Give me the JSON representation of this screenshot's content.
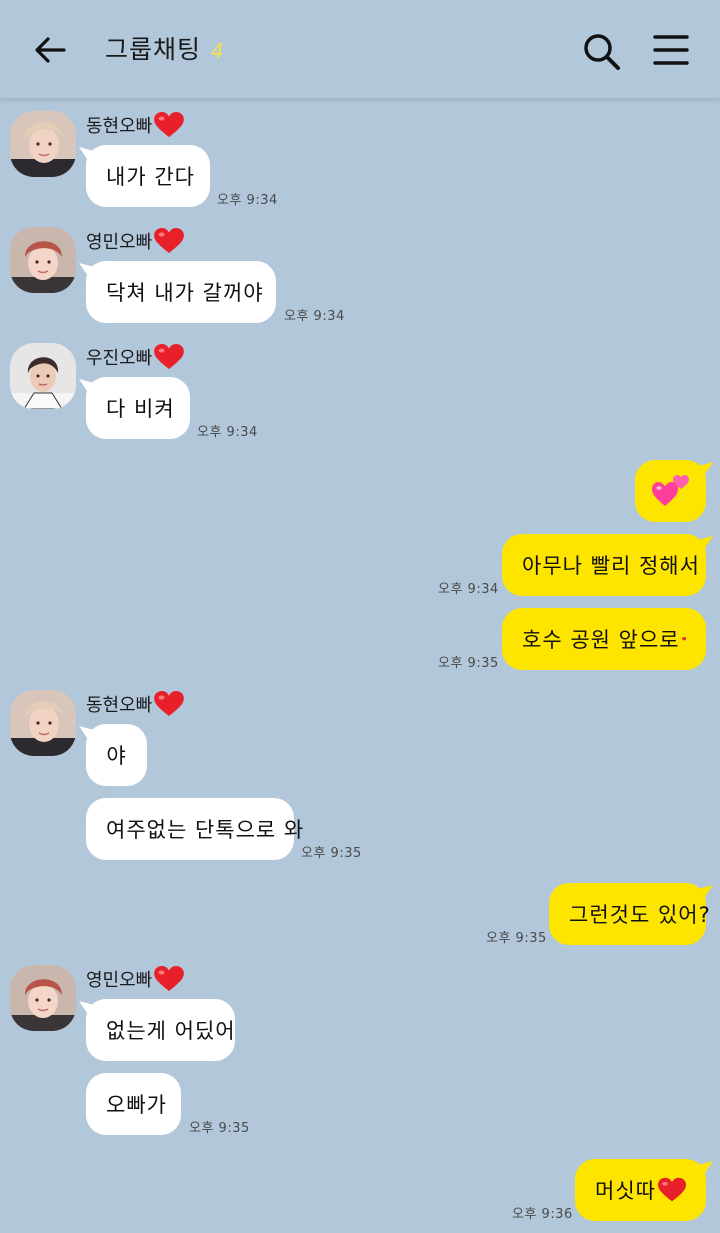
{
  "header": {
    "title": "그룹채팅",
    "member_count": "4",
    "back_icon": "back-arrow-icon",
    "search_icon": "search-icon",
    "menu_icon": "hamburger-menu-icon"
  },
  "messages": [
    {
      "sender": "동현오빠",
      "text": "내가 간다",
      "time": "오후 9:34"
    },
    {
      "sender": "영민오빠",
      "text": "닥쳐 내가 갈꺼야",
      "time": "오후 9:34"
    },
    {
      "sender": "우진오빠",
      "text": "다 비켜",
      "time": "오후 9:34"
    },
    {
      "sender": "me",
      "text": "💕",
      "time": ""
    },
    {
      "sender": "me",
      "text": "아무나 빨리 정해서",
      "time": "오후 9:34"
    },
    {
      "sender": "me",
      "text": "호수 공원 앞으로",
      "time": "오후 9:35"
    },
    {
      "sender": "동현오빠",
      "text": "야",
      "time": ""
    },
    {
      "sender": "동현오빠",
      "text": "여주없는 단톡으로 와",
      "time": "오후 9:35"
    },
    {
      "sender": "me",
      "text": "그런것도 있어?",
      "time": "오후 9:35"
    },
    {
      "sender": "영민오빠",
      "text": "없는게 어딨어",
      "time": ""
    },
    {
      "sender": "영민오빠",
      "text": "오빠가",
      "time": "오후 9:35"
    },
    {
      "sender": "me",
      "text": "머싯따",
      "time": "오후 9:36"
    }
  ],
  "colors": {
    "background": "#b2c7da",
    "sent_bubble": "#fee500",
    "received_bubble": "#ffffff",
    "heart": "#e8202a"
  }
}
